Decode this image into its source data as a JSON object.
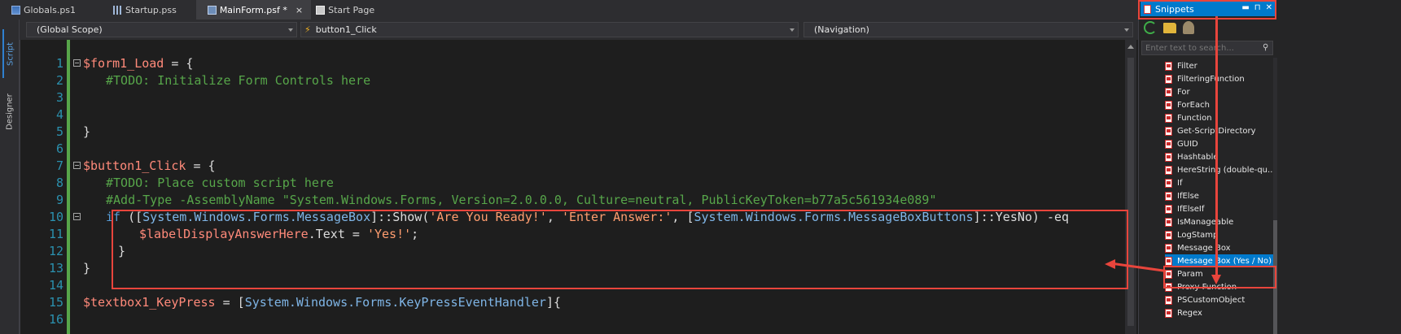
{
  "tabs": [
    {
      "label": "Globals.ps1",
      "icon": "document-icon",
      "active": false
    },
    {
      "label": "Startup.pss",
      "icon": "grid-icon",
      "active": false
    },
    {
      "label": "MainForm.psf *",
      "icon": "form-icon",
      "active": true,
      "close": "×"
    },
    {
      "label": "Start Page",
      "icon": "page-icon",
      "active": false
    }
  ],
  "side_tabs": {
    "script": "Script",
    "designer": "Designer"
  },
  "dropdowns": {
    "scope": "(Global Scope)",
    "function": "button1_Click",
    "navigation": "(Navigation)"
  },
  "code_lines": [
    {
      "n": "1"
    },
    {
      "n": "2"
    },
    {
      "n": "3"
    },
    {
      "n": "4"
    },
    {
      "n": "5"
    },
    {
      "n": "6"
    },
    {
      "n": "7"
    },
    {
      "n": "8"
    },
    {
      "n": "9"
    },
    {
      "n": "10"
    },
    {
      "n": "11"
    },
    {
      "n": "12"
    },
    {
      "n": "13"
    },
    {
      "n": "14"
    },
    {
      "n": "15"
    },
    {
      "n": "16"
    }
  ],
  "code": {
    "l2_var": "$form1_Load",
    "l2_op": " = {",
    "l3": "#TODO: Initialize Form Controls here",
    "l6": "}",
    "l8_var": "$button1_Click",
    "l8_op": " = {",
    "l9": "#TODO: Place custom script here",
    "l10": "#Add-Type -AssemblyName \"System.Windows.Forms, Version=2.0.0.0, Culture=neutral, PublicKeyToken=b77a5c561934e089\"",
    "l11_if": "if",
    "l11_a": " ([",
    "l11_type1": "System.Windows.Forms.MessageBox",
    "l11_b": "]::Show(",
    "l11_s1": "'Are You Ready!'",
    "l11_c": ", ",
    "l11_s2": "'Enter Answer:'",
    "l11_d": ", [",
    "l11_type2": "System.Windows.Forms.MessageBoxButtons",
    "l11_e": "]::YesNo) -eq",
    "l12_var": "$labelDisplayAnswerHere",
    "l12_a": ".Text = ",
    "l12_s": "'Yes!'",
    "l12_b": ";",
    "l13": "}",
    "l14": "}",
    "l16_var": "$textbox1_KeyPress",
    "l16_op": " = [",
    "l16_type": "System.Windows.Forms.KeyPressEventHandler",
    "l16_b": "]{"
  },
  "snippets": {
    "title": "Snippets",
    "title_buttons": [
      "▬",
      "⊓",
      "✕"
    ],
    "search_placeholder": "Enter text to search...",
    "items": [
      "Filter",
      "FilteringFunction",
      "For",
      "ForEach",
      "Function",
      "Get-ScriptDirectory",
      "GUID",
      "Hashtable",
      "HereString (double-qu...",
      "If",
      "IfElse",
      "IfElseIf",
      "IsManageable",
      "LogStamp",
      "Message Box",
      "Message Box (Yes / No)",
      "Param",
      "Proxy Function",
      "PSCustomObject",
      "Regex"
    ],
    "selected_index": 15
  },
  "colors": {
    "accent": "#007acc",
    "highlight": "#e8453c",
    "comment": "#57a64a",
    "variable": "#ff8a7a",
    "string": "#ff9d6f",
    "keyword": "#569cd6"
  }
}
